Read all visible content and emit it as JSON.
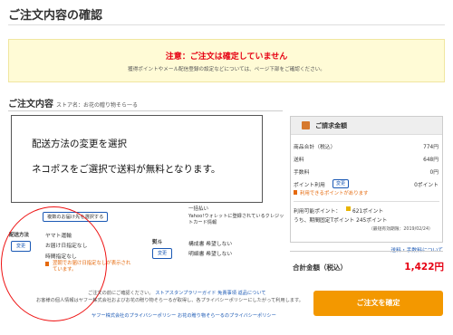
{
  "page": {
    "title": "ご注文内容の確認"
  },
  "notice": {
    "title": "注意：ご注文は確定していません",
    "subtitle": "獲得ポイントやメール配信登録の設定などについては、ページ下部をご確認ください。"
  },
  "order": {
    "title": "ご注文内容",
    "store": "ストア名：お花の贈り物そら一る"
  },
  "callout": {
    "line1": "配送方法の変更を選択",
    "line2": "ネコポスをご選択で送料が無料となります。"
  },
  "payment": {
    "label": "一括払い",
    "wallet": "Yahoo!ウォレットに登録されているクレジットカード情報"
  },
  "shipping": {
    "change_address_button": "複数のお届け先を選択する",
    "label": "配送方法",
    "change_button": "変更",
    "method": "ヤマト運輸",
    "date": "お届け日指定なし",
    "time": "時間指定なし",
    "warning": "翌朝でお届け日指定なしが表示されています。"
  },
  "wrapping": {
    "label": "熨斗",
    "change_button": "変更",
    "line1": "構成書 希望しない",
    "line2": "明細書 希望しない"
  },
  "billing": {
    "header": "ご請求金額",
    "rows": [
      {
        "label": "商品合計（税込）",
        "value": "774円"
      },
      {
        "label": "送料",
        "value": "648円"
      },
      {
        "label": "手数料",
        "value": "0円"
      }
    ],
    "points_label": "ポイント利用",
    "points_button": "変更",
    "points_value": "0ポイント",
    "points_note": "利用できるポイントがあります",
    "available_label": "利用可能ポイント：",
    "available_value": "621ポイント",
    "limited_text": "うち、期間固定Tポイント 245ポイント",
    "limited_note": "（最短有効期限：2019/02/24）",
    "shipping_fee_link": "送料・手数料について",
    "total_label": "合計金額（税込）",
    "total_value": "1,422円"
  },
  "confirm_button": "ご注文を確定",
  "footer": {
    "line1_prefix": "ご注文の前にご確認ください。",
    "links": [
      "ストアスタンプラリーガイド",
      "免責事項",
      "返品について"
    ],
    "line2": "お客様の個人情報はヤフー株式会社およびお花の贈り物そら一るが取得し、各プライバシーポリシーにしたがって利用します。",
    "line3a": "ヤフー株式会社のプライバシーポリシー",
    "line3b": "お花の贈り物そら一るのプライバシーポリシー"
  },
  "colors": {
    "accent": "#f39800",
    "alert": "#e60012",
    "link": "#1a58b4",
    "notice_bg": "#fffbd6"
  }
}
